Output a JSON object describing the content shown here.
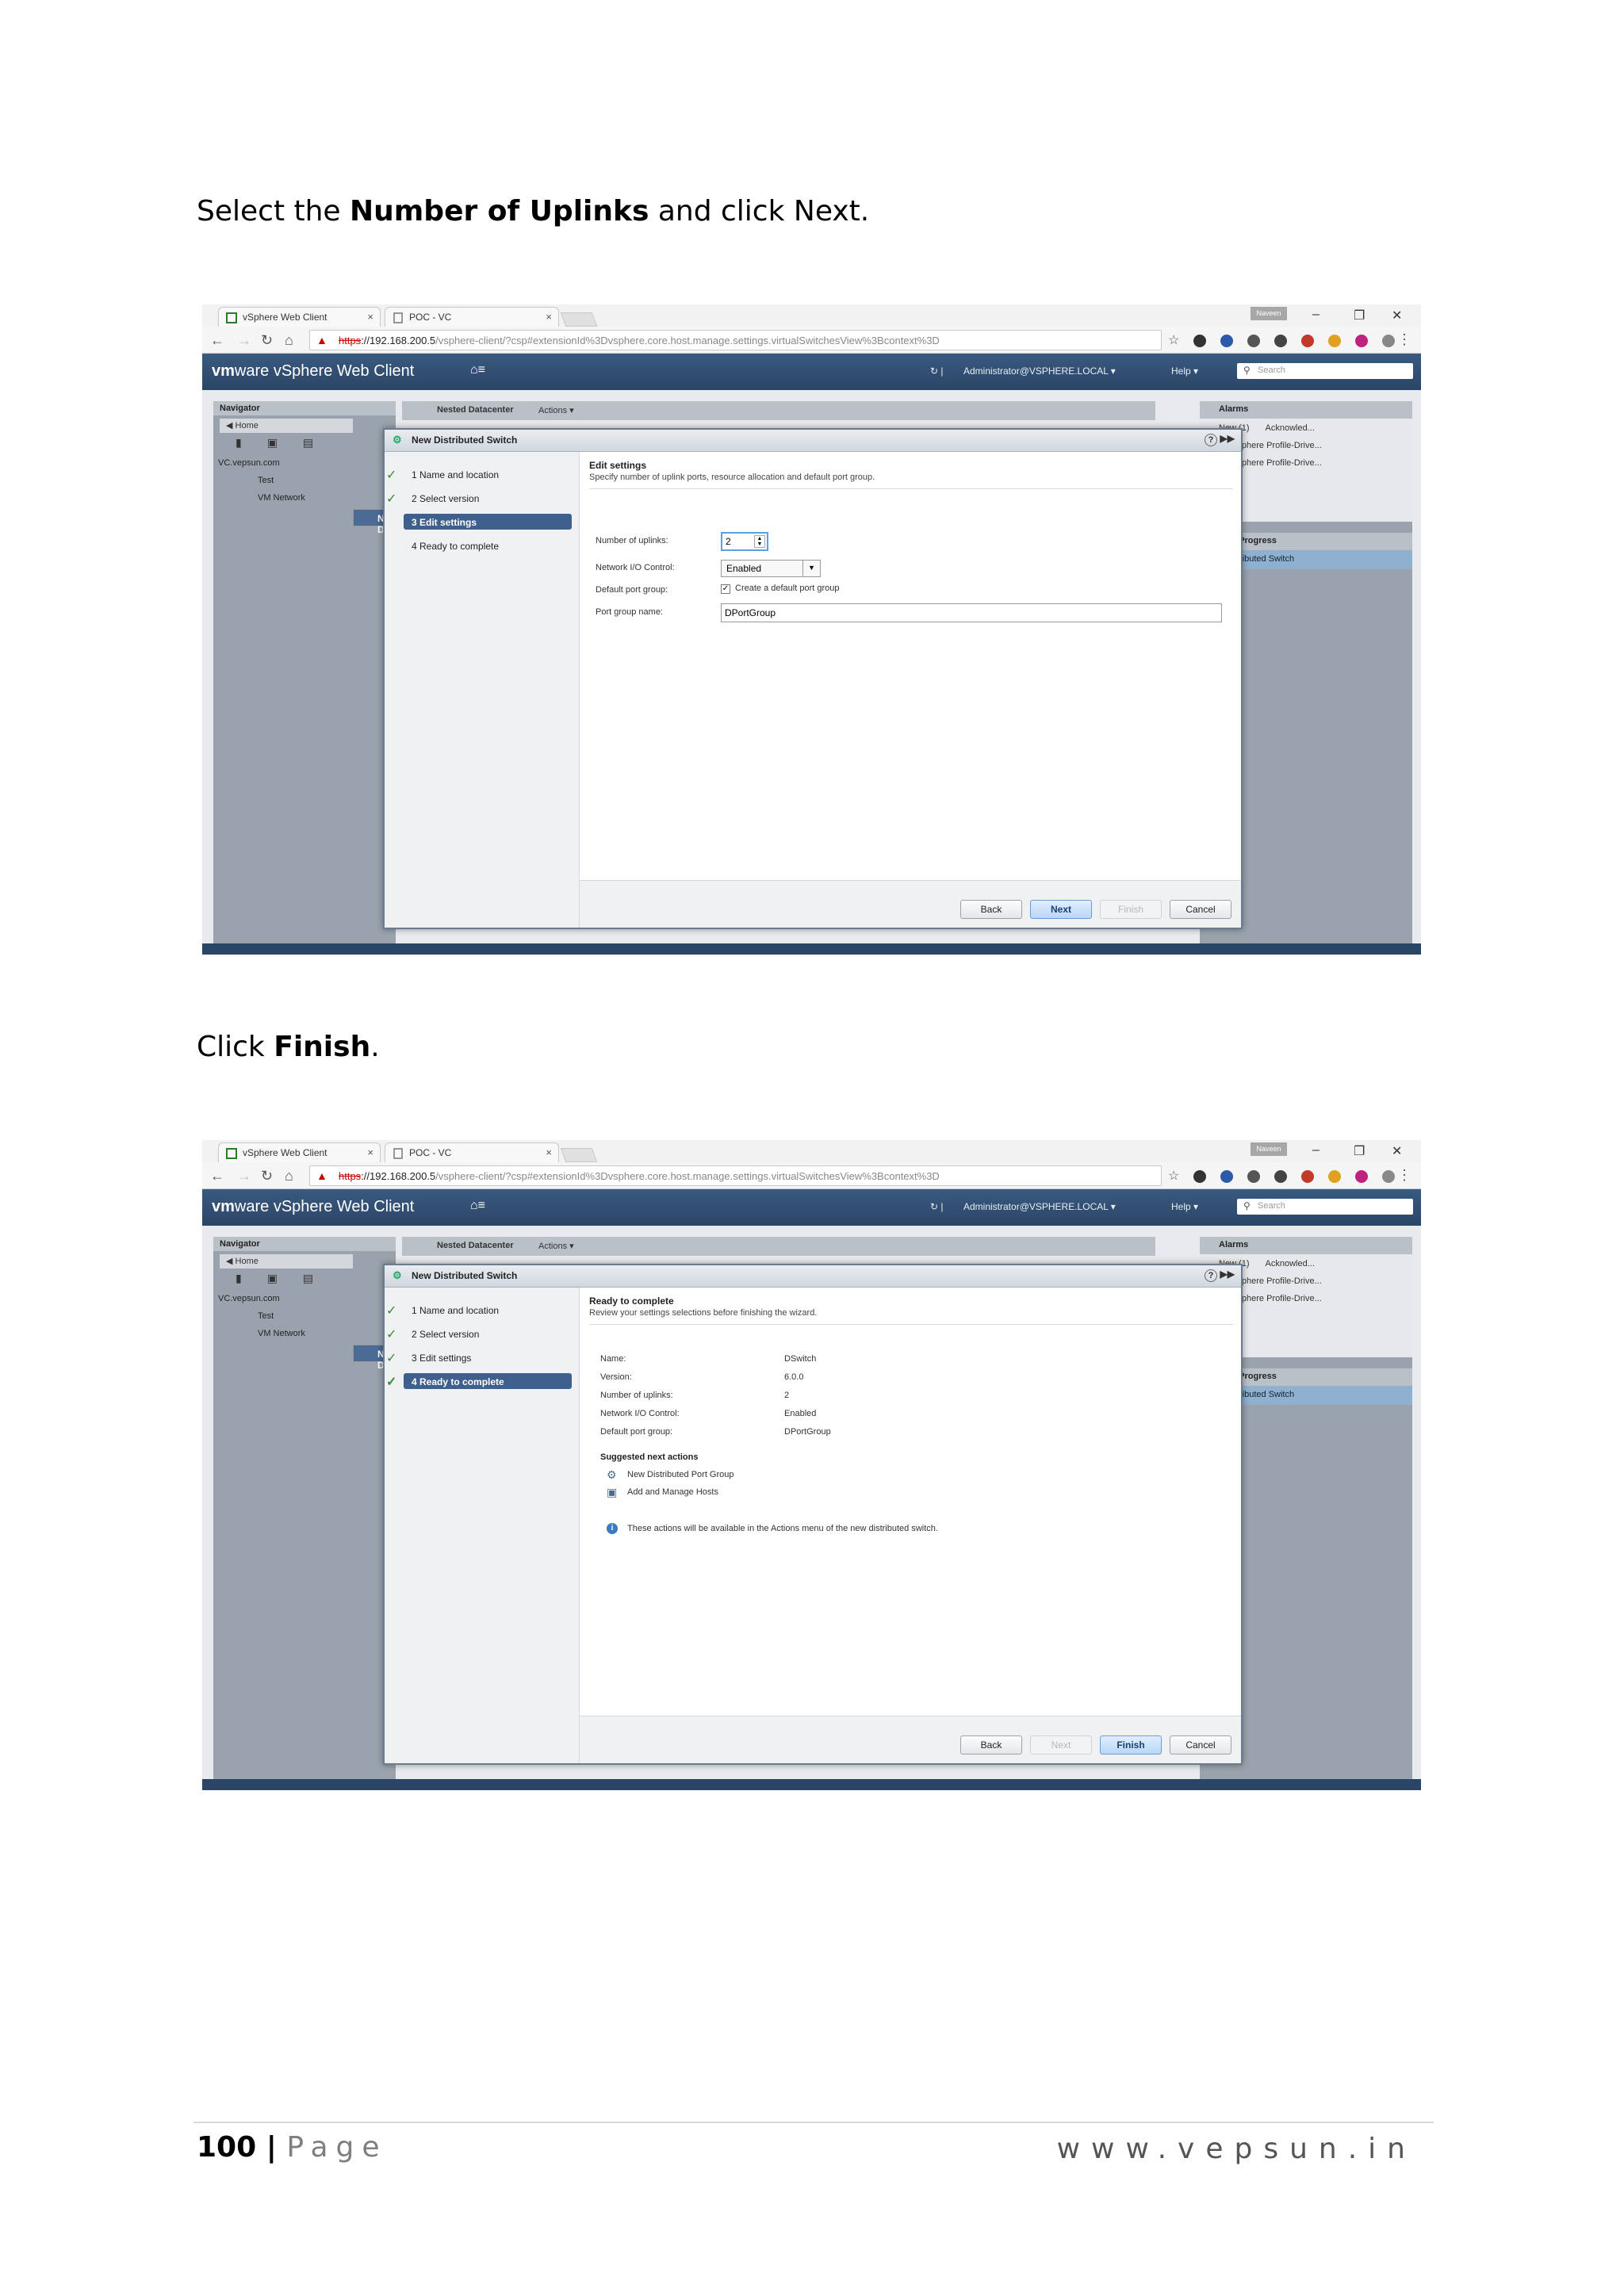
{
  "instructions": {
    "step1_pre": "Select the ",
    "step1_bold": "Number of Uplinks",
    "step1_post": " and click Next.",
    "step2_pre": "Click ",
    "step2_bold": "Finish",
    "step2_post": "."
  },
  "browser": {
    "tab1": "vSphere Web Client",
    "tab2": "POC - VC",
    "user_chip": "Naveen",
    "url_https": "https",
    "url_host": "://192.168.200.5",
    "url_path": "/vsphere-client/?csp#extensionId%3Dvsphere.core.host.manage.settings.virtualSwitchesView%3Bcontext%3D"
  },
  "vsphere": {
    "logo_vm": "vm",
    "logo_ware": "ware",
    "logo_product": " vSphere Web Client",
    "user_menu": "Administrator@VSPHERE.LOCAL ▾",
    "help_menu": "Help ▾",
    "search_placeholder": "Search",
    "navigator": "Navigator",
    "home": "◀ Home",
    "tree_vc": "VC.vepsun.com",
    "tree_dc": "Nested Datacenter",
    "tree_test": "Test",
    "tree_vmnet": "VM Network",
    "mid_dc": "Nested Datacenter",
    "mid_actions": "Actions ▾",
    "alarms": "Alarms",
    "alarm_new": "New (1)",
    "alarm_ack": "Acknowled...",
    "alarm_item1": "Mware vSphere Profile-Drive...",
    "alarm_item2": "Mware vSphere Profile-Drive...",
    "wip": "Work In Progress",
    "wip_item": "New Distributed Switch"
  },
  "wizard": {
    "title": "New Distributed Switch",
    "steps": [
      "1  Name and location",
      "2  Select version",
      "3  Edit settings",
      "4  Ready to complete"
    ],
    "back": "Back",
    "next": "Next",
    "finish": "Finish",
    "cancel": "Cancel"
  },
  "edit_settings": {
    "title": "Edit settings",
    "subtitle": "Specify number of uplink ports, resource allocation and default port group.",
    "uplinks_label": "Number of uplinks:",
    "uplinks_value": "2",
    "nioc_label": "Network I/O Control:",
    "nioc_value": "Enabled",
    "default_pg_label": "Default port group:",
    "default_pg_checkbox": "Create a default port group",
    "pg_name_label": "Port group name:",
    "pg_name_value": "DPortGroup"
  },
  "ready": {
    "title": "Ready to complete",
    "subtitle": "Review your settings selections before finishing the wizard.",
    "name_label": "Name:",
    "name_value": "DSwitch",
    "version_label": "Version:",
    "version_value": "6.0.0",
    "uplinks_label": "Number of uplinks:",
    "uplinks_value": "2",
    "nioc_label": "Network I/O Control:",
    "nioc_value": "Enabled",
    "pg_label": "Default port group:",
    "pg_value": "DPortGroup",
    "next_actions": "Suggested next actions",
    "action1": "New Distributed Port Group",
    "action2": "Add and Manage Hosts",
    "info": "These actions will be available in the Actions menu of the new distributed switch."
  },
  "footer": {
    "page_number": "100",
    "separator": " | ",
    "page_word": "Page",
    "site": "www.vepsun.in"
  }
}
